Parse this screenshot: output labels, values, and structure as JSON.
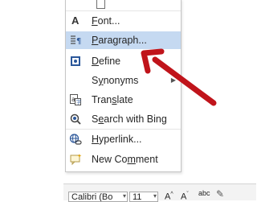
{
  "context_menu": {
    "items": [
      {
        "id": "font",
        "label": "Font...",
        "underline_char": "F",
        "icon": "font-a-icon"
      },
      {
        "id": "paragraph",
        "label": "Paragraph...",
        "underline_char": "P",
        "icon": "paragraph-icon",
        "highlighted": true
      },
      {
        "id": "define",
        "label": "Define",
        "underline_char": "D",
        "icon": "book-icon"
      },
      {
        "id": "synonyms",
        "label": "Synonyms",
        "underline_char": "y",
        "icon": "",
        "has_submenu": true
      },
      {
        "id": "translate",
        "label": "Translate",
        "underline_char": "s",
        "icon": "translate-icon"
      },
      {
        "id": "search_bing",
        "label": "Search with Bing",
        "underline_char": "e",
        "icon": "search-icon"
      },
      {
        "id": "hyperlink",
        "label": "Hyperlink...",
        "underline_char": "H",
        "icon": "hyperlink-icon"
      },
      {
        "id": "new_comment",
        "label": "New Comment",
        "underline_char": "m",
        "icon": "comment-icon"
      }
    ]
  },
  "mini_toolbar": {
    "font_name": "Calibri (Bo",
    "font_size": "11",
    "grow_font": "A",
    "shrink_font": "A",
    "styles_label": "abc"
  },
  "colors": {
    "highlight": "#c5d9f1",
    "arrow": "#c0141b",
    "menu_border": "#c6c6c6",
    "icon_blue": "#2b579a"
  }
}
